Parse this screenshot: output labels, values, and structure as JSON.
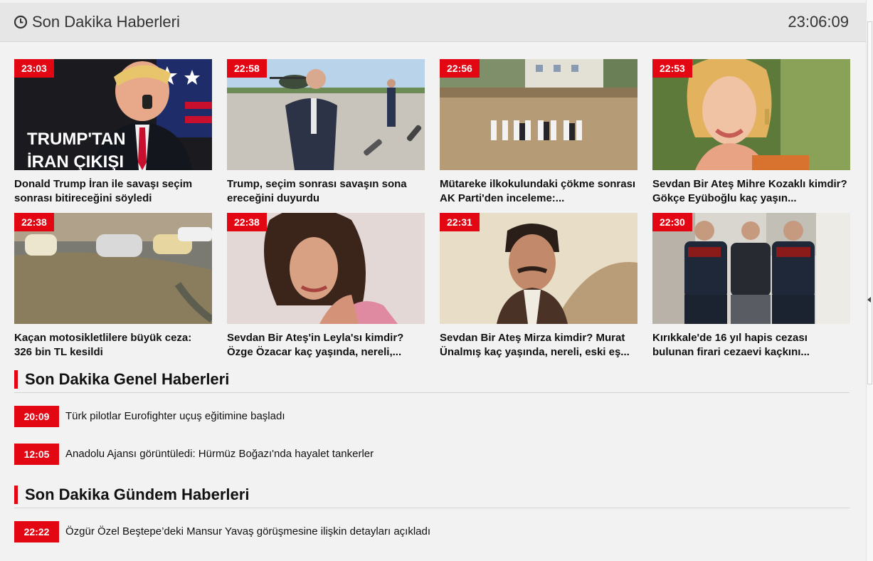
{
  "header": {
    "title": "Son Dakika Haberleri",
    "time": "23:06:09",
    "icon": "clock-icon"
  },
  "cards": [
    {
      "time": "23:03",
      "title": "Donald Trump İran ile savaşı seçim sonrası bitireceğini söyledi",
      "overlay": "TRUMP'TAN İRAN ÇIKIŞI"
    },
    {
      "time": "22:58",
      "title": "Trump, seçim sonrası savaşın sona ereceğini duyurdu"
    },
    {
      "time": "22:56",
      "title": "Mütareke ilkokulundaki çökme sonrası AK Parti'den inceleme:..."
    },
    {
      "time": "22:53",
      "title": "Sevdan Bir Ateş Mihre Kozaklı kimdir? Gökçe Eyüboğlu kaç yaşın..."
    },
    {
      "time": "22:38",
      "title": "Kaçan motosikletlilere büyük ceza: 326 bin TL kesildi"
    },
    {
      "time": "22:38",
      "title": "Sevdan Bir Ateş'in Leyla'sı kimdir? Özge Özacar kaç yaşında, nereli,..."
    },
    {
      "time": "22:31",
      "title": "Sevdan Bir Ateş Mirza kimdir? Murat Ünalmış kaç yaşında, nereli, eski eş..."
    },
    {
      "time": "22:30",
      "title": "Kırıkkale'de 16 yıl hapis cezası bulunan firari cezaevi kaçkını..."
    }
  ],
  "sections": [
    {
      "title": "Son Dakika Genel Haberleri",
      "items": [
        {
          "time": "20:09",
          "title": "Türk pilotlar Eurofighter uçuş eğitimine başladı"
        },
        {
          "time": "12:05",
          "title": "Anadolu Ajansı görüntüledi: Hürmüz Boğazı'nda hayalet tankerler"
        }
      ]
    },
    {
      "title": "Son Dakika Gündem Haberleri",
      "items": [
        {
          "time": "22:22",
          "title": "Özgür Özel Beştepe’deki Mansur Yavaş görüşmesine ilişkin detayları açıkladı"
        }
      ]
    }
  ],
  "colors": {
    "accent": "#e30613",
    "background": "#f2f2f2",
    "header": "#e6e6e6"
  }
}
